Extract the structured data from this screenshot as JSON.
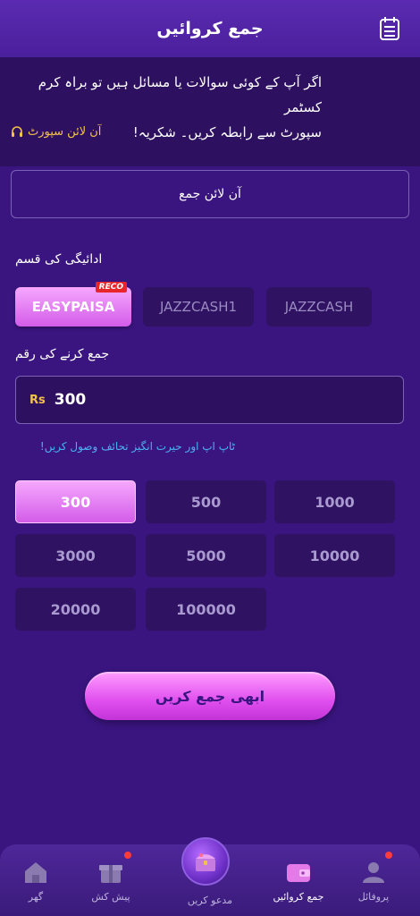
{
  "header": {
    "title": "جمع کروائیں",
    "icon": "calendar-icon"
  },
  "notice": {
    "line1": "اگر آپ کے کوئی سوالات یا مسائل ہیں تو براہ کرم کسٹمر",
    "line2": "سپورٹ سے رابطہ کریں۔ شکریہ!",
    "support_label": "آن لائن سپورٹ",
    "support_icon": "headset-icon"
  },
  "online_deposit_label": "آن لائن جمع",
  "payment": {
    "label": "ادائیگی کی قسم",
    "methods": [
      "EASYPAISA",
      "JAZZCASH1",
      "JAZZCASH"
    ],
    "selected": 0,
    "badge": "RECO"
  },
  "amount": {
    "label": "جمع کرنے کی رقم",
    "currency": "Rs",
    "value": "300"
  },
  "promo": "ٹاپ اپ اور حیرت انگیز تحائف وصول کریں!",
  "chips": [
    "300",
    "500",
    "1000",
    "3000",
    "5000",
    "10000",
    "20000",
    "100000"
  ],
  "selected_chip": 0,
  "submit_label": "ابھی جمع کریں",
  "nav": {
    "home": "گھر",
    "offers": "پیش کش",
    "invite": "مدعو کریں",
    "deposit": "جمع کروائیں",
    "profile": "پروفائل"
  },
  "colors": {
    "background": "#3a1580",
    "accent_pink": "#d35ce8",
    "gold": "#f3c24a",
    "link_blue": "#4ab1f1"
  }
}
